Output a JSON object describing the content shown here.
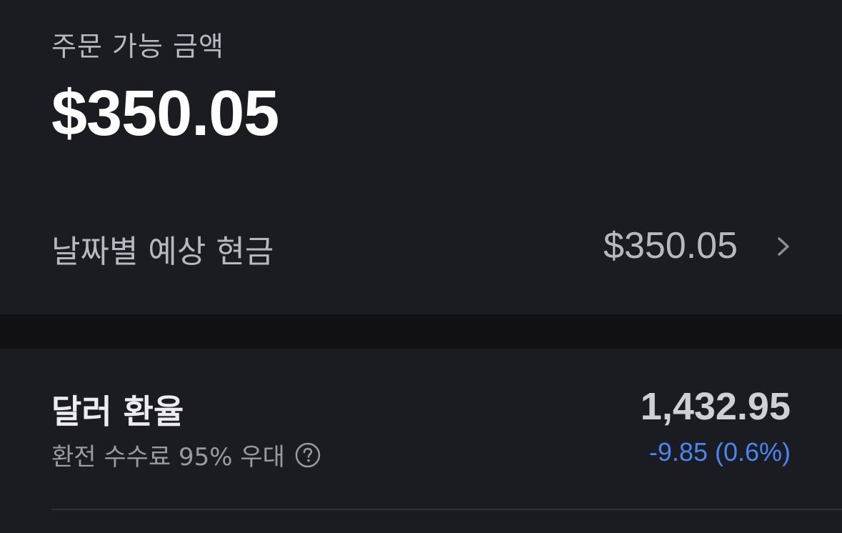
{
  "order": {
    "label": "주문 가능 금액",
    "amount": "$350.05"
  },
  "cash_by_date": {
    "label": "날짜별 예상 현금",
    "value": "$350.05",
    "icon": "chevron-right-icon"
  },
  "fx": {
    "title": "달러 환율",
    "subtitle": "환전 수수료 95% 우대",
    "help_icon": "question-circle-icon",
    "rate": "1,432.95",
    "change": "-9.85 (0.6%)",
    "change_color": "#4b86f0"
  }
}
